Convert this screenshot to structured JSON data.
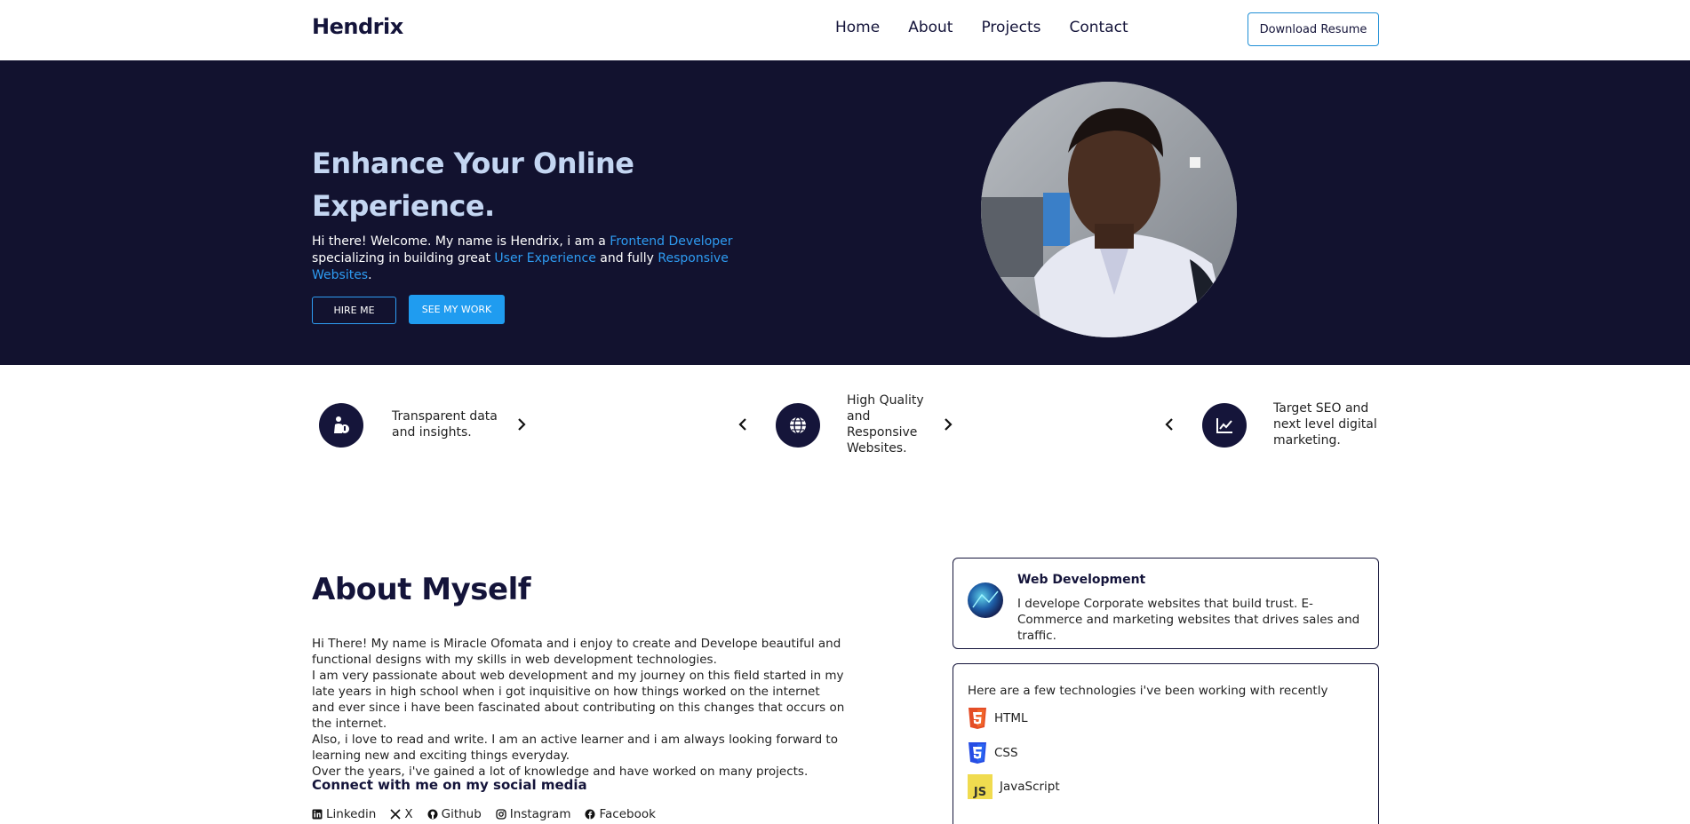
{
  "nav": {
    "brand": "Hendrix",
    "links": [
      "Home",
      "About",
      "Projects",
      "Contact"
    ],
    "resume_label": "Download Resume"
  },
  "hero": {
    "title": "Enhance Your Online Experience.",
    "intro_a": "Hi there! Welcome. My name is Hendrix, i am a ",
    "hl_role": "Frontend Developer",
    "intro_b": " specializing in building great ",
    "hl_ux": "User Experience",
    "intro_c": " and fully ",
    "hl_responsive": "Responsive Websites",
    "intro_d": ".",
    "hire_label": "HIRE ME",
    "work_label": "SEE MY WORK"
  },
  "features": [
    {
      "text": "Transparent data and insights.",
      "icon": "person-data-icon"
    },
    {
      "text": "High Quality and Responsive Websites.",
      "icon": "globe-icon"
    },
    {
      "text": "Target SEO and next level digital marketing.",
      "icon": "chart-line-icon"
    }
  ],
  "about": {
    "title": "About Myself",
    "paragraphs": [
      "Hi There! My name is Miracle Ofomata and i enjoy to create and Develope beautiful and functional designs with my skills in web development technologies.",
      "I am very passionate about web development and my journey on this field started in my late years in high school when i got inquisitive on how things worked on the internet and ever since i have been fascinated about contributing on this changes that occurs on the internet.",
      "Also, i love to read and write. I am an active learner and i am always looking forward to learning new and exciting things everyday.",
      "Over the years, i've gained a lot of knowledge and have worked on many projects."
    ],
    "connect_title": "Connect with me on my social media",
    "socials": [
      "Linkedin",
      "X",
      "Github",
      "Instagram",
      "Facebook"
    ]
  },
  "web_card": {
    "title": "Web Development",
    "desc": "I develope Corporate websites that build trust. E-Commerce and marketing websites that drives sales and traffic."
  },
  "tech_card": {
    "intro": "Here are a few technologies i've been working with recently",
    "items": [
      "HTML",
      "CSS",
      "JavaScript"
    ]
  },
  "colors": {
    "navy": "#12122f",
    "accent": "#1f9cf0",
    "title_light": "#c4d6f2"
  }
}
